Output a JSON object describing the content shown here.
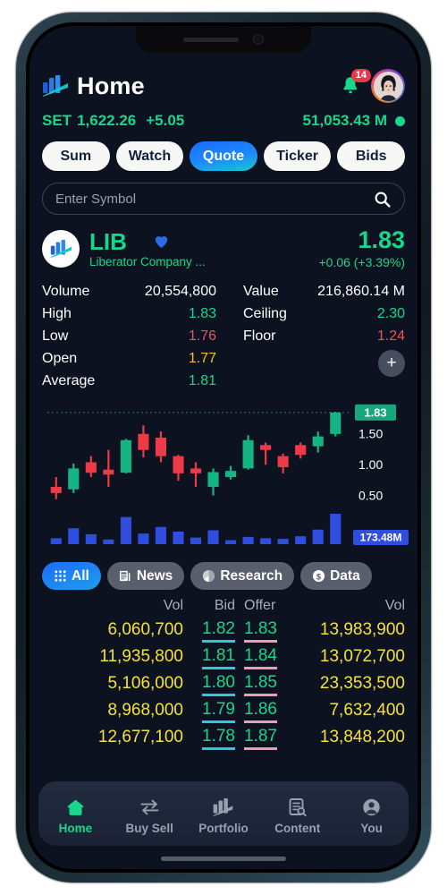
{
  "header": {
    "title": "Home",
    "logo_icon": "liberator-bars-icon",
    "bell_icon": "bell-icon",
    "notification_count": "14",
    "avatar_icon": "user-avatar"
  },
  "index": {
    "name": "SET",
    "value": "1,622.26",
    "change": "+5.05",
    "market_value": "51,053.43 M",
    "status_icon": "market-open-dot"
  },
  "tabs": [
    {
      "label": "Sum",
      "active": false
    },
    {
      "label": "Watch",
      "active": false
    },
    {
      "label": "Quote",
      "active": true
    },
    {
      "label": "Ticker",
      "active": false
    },
    {
      "label": "Bids",
      "active": false
    }
  ],
  "search": {
    "placeholder": "Enter Symbol",
    "value": "",
    "icon": "search-icon"
  },
  "symbol": {
    "code": "LIB",
    "name": "Liberator Company ...",
    "favorite_icon": "heart-icon",
    "logo_icon": "liberator-bars-icon",
    "price": "1.83",
    "change": "+0.06 (+3.39%)"
  },
  "stats": {
    "left": [
      {
        "key": "Volume",
        "value": "20,554,800",
        "color": "#ffffff"
      },
      {
        "key": "High",
        "value": "1.83",
        "color": "#18d68c"
      },
      {
        "key": "Low",
        "value": "1.76",
        "color": "#e8545a"
      },
      {
        "key": "Open",
        "value": "1.77",
        "color": "#f4c023"
      },
      {
        "key": "Average",
        "value": "1.81",
        "color": "#18d68c"
      }
    ],
    "right": [
      {
        "key": "Value",
        "value": "216,860.14 M",
        "color": "#ffffff"
      },
      {
        "key": "Ceiling",
        "value": "2.30",
        "color": "#18d68c"
      },
      {
        "key": "Floor",
        "value": "1.24",
        "color": "#e8545a"
      }
    ],
    "add_button": "+"
  },
  "chart_data": {
    "type": "candlestick",
    "title": "",
    "price_axis_labels": [
      "1.50",
      "1.00",
      "0.50"
    ],
    "current_price_label": "1.83",
    "volume_label": "173.48M",
    "ylim": [
      0.3,
      1.9
    ],
    "grid": false,
    "candles": [
      {
        "open": 0.62,
        "close": 0.52,
        "high": 0.78,
        "low": 0.42,
        "dir": "down"
      },
      {
        "open": 0.58,
        "close": 0.92,
        "high": 1.0,
        "low": 0.52,
        "dir": "up"
      },
      {
        "open": 1.02,
        "close": 0.85,
        "high": 1.12,
        "low": 0.78,
        "dir": "down"
      },
      {
        "open": 0.9,
        "close": 0.82,
        "high": 1.22,
        "low": 0.62,
        "dir": "down"
      },
      {
        "open": 0.85,
        "close": 1.38,
        "high": 1.4,
        "low": 0.84,
        "dir": "up"
      },
      {
        "open": 1.48,
        "close": 1.22,
        "high": 1.62,
        "low": 1.1,
        "dir": "down"
      },
      {
        "open": 1.42,
        "close": 1.12,
        "high": 1.52,
        "low": 1.02,
        "dir": "down"
      },
      {
        "open": 1.12,
        "close": 0.84,
        "high": 1.14,
        "low": 0.72,
        "dir": "down"
      },
      {
        "open": 0.92,
        "close": 0.84,
        "high": 1.02,
        "low": 0.62,
        "dir": "down"
      },
      {
        "open": 0.62,
        "close": 0.86,
        "high": 0.92,
        "low": 0.48,
        "dir": "up"
      },
      {
        "open": 0.78,
        "close": 0.88,
        "high": 0.96,
        "low": 0.74,
        "dir": "up"
      },
      {
        "open": 0.92,
        "close": 1.38,
        "high": 1.46,
        "low": 0.9,
        "dir": "up"
      },
      {
        "open": 1.3,
        "close": 1.22,
        "high": 1.34,
        "low": 0.98,
        "dir": "down"
      },
      {
        "open": 1.12,
        "close": 0.94,
        "high": 1.16,
        "low": 0.84,
        "dir": "down"
      },
      {
        "open": 1.3,
        "close": 1.14,
        "high": 1.34,
        "low": 1.08,
        "dir": "down"
      },
      {
        "open": 1.28,
        "close": 1.44,
        "high": 1.52,
        "low": 1.18,
        "dir": "up"
      },
      {
        "open": 1.48,
        "close": 1.83,
        "high": 1.84,
        "low": 1.44,
        "dir": "up"
      }
    ],
    "volumes": [
      18,
      48,
      30,
      14,
      82,
      32,
      52,
      38,
      20,
      42,
      12,
      22,
      18,
      16,
      24,
      44,
      92
    ]
  },
  "filters": [
    {
      "label": "All",
      "icon": "grid-icon",
      "active": true
    },
    {
      "label": "News",
      "icon": "news-icon",
      "active": false
    },
    {
      "label": "Research",
      "icon": "research-icon",
      "active": false
    },
    {
      "label": "Data",
      "icon": "dollar-icon",
      "active": false
    }
  ],
  "bid_offer": {
    "headers": {
      "vol_left": "Vol",
      "bid": "Bid",
      "offer": "Offer",
      "vol_right": "Vol"
    },
    "rows": [
      {
        "vol_left": "6,060,700",
        "bid": "1.82",
        "offer": "1.83",
        "vol_right": "13,983,900"
      },
      {
        "vol_left": "11,935,800",
        "bid": "1.81",
        "offer": "1.84",
        "vol_right": "13,072,700"
      },
      {
        "vol_left": "5,106,000",
        "bid": "1.80",
        "offer": "1.85",
        "vol_right": "23,353,500"
      },
      {
        "vol_left": "8,968,000",
        "bid": "1.79",
        "offer": "1.86",
        "vol_right": "7,632,400"
      },
      {
        "vol_left": "12,677,100",
        "bid": "1.78",
        "offer": "1.87",
        "vol_right": "13,848,200"
      }
    ]
  },
  "bottom_nav": [
    {
      "label": "Home",
      "icon": "home-icon",
      "active": true
    },
    {
      "label": "Buy Sell",
      "icon": "transfer-arrows-icon",
      "active": false
    },
    {
      "label": "Portfolio",
      "icon": "bars-icon",
      "active": false
    },
    {
      "label": "Content",
      "icon": "document-search-icon",
      "active": false
    },
    {
      "label": "You",
      "icon": "person-icon",
      "active": false
    }
  ],
  "colors": {
    "green": "#18d68c",
    "red": "#e8545a",
    "yellow": "#f4e13d",
    "blue": "#2f4ee0",
    "bg": "#0d1220"
  }
}
